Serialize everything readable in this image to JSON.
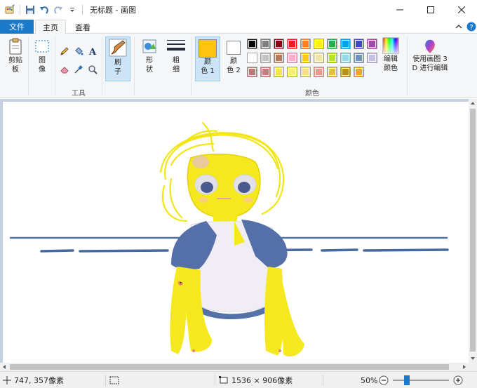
{
  "window": {
    "title": "无标题 - 画图"
  },
  "tabs": {
    "file": "文件",
    "home": "主页",
    "view": "查看"
  },
  "ribbon": {
    "clipboard": {
      "label_1": "剪贴",
      "label_2": "板"
    },
    "image": {
      "label_1": "图",
      "label_2": "像"
    },
    "tools": {
      "group_label": "工具"
    },
    "brush": {
      "label_1": "刷",
      "label_2": "子"
    },
    "shapes": {
      "label_1": "形",
      "label_2": "状"
    },
    "size": {
      "label_1": "粗",
      "label_2": "细"
    },
    "color1": {
      "label_1": "颜",
      "label_2": "色 1",
      "value": "#ffc20e"
    },
    "color2": {
      "label_1": "颜",
      "label_2": "色 2",
      "value": "#ffffff"
    },
    "colors": {
      "group_label": "颜色",
      "palette_row1": [
        "#000000",
        "#7f7f7f",
        "#880015",
        "#ed1c24",
        "#ff7f27",
        "#fff200",
        "#22b14c",
        "#00a2e8",
        "#3f48cc",
        "#a349a4"
      ],
      "palette_row2": [
        "#ffffff",
        "#c3c3c3",
        "#b97a57",
        "#ffaec9",
        "#ffc90e",
        "#efe4b0",
        "#b5e61d",
        "#99d9ea",
        "#7092be",
        "#c8bfe7"
      ],
      "palette_row3": [
        "#b97a78",
        "#c87d7d",
        "#f5e44a",
        "#f7ef6b",
        "#f9e07a",
        "#e99a8c",
        "#e3c13a",
        "#b88f1e",
        "#f2a51e"
      ]
    },
    "edit_colors": {
      "label_1": "编辑",
      "label_2": "颜色"
    },
    "paint3d": {
      "label_1": "使用画图 3",
      "label_2": "D 进行编辑"
    }
  },
  "status": {
    "cursor_pos": "747, 357像素",
    "image_size": "1536 × 906像素",
    "zoom": "50%"
  }
}
